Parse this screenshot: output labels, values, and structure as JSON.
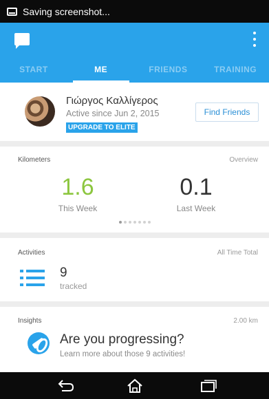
{
  "status_bar": {
    "notification": "Saving screenshot..."
  },
  "app_bar": {
    "tabs": [
      {
        "label": "START",
        "active": false
      },
      {
        "label": "ME",
        "active": true
      },
      {
        "label": "FRIENDS",
        "active": false
      },
      {
        "label": "TRAINING",
        "active": false
      }
    ],
    "accent_color": "#2aa3ea"
  },
  "profile": {
    "name": "Γιώργος Καλλίγερος",
    "active_since": "Active since Jun 2, 2015",
    "upgrade_label": "UPGRADE TO ELITE",
    "find_friends_label": "Find Friends"
  },
  "kilometers": {
    "title": "Kilometers",
    "aside": "Overview",
    "this_week": {
      "value": "1.6",
      "label": "This Week",
      "color": "#8cc63f"
    },
    "last_week": {
      "value": "0.1",
      "label": "Last Week"
    },
    "pager": {
      "count": 7,
      "active": 0
    }
  },
  "activities": {
    "title": "Activities",
    "aside": "All Time Total",
    "count": "9",
    "count_label": "tracked"
  },
  "insights": {
    "title": "Insights",
    "aside": "2.00 km",
    "headline": "Are you progressing?",
    "subtext": "Learn more about those 9 activities!"
  },
  "icons": [
    "screenshot-icon",
    "chat-icon",
    "overflow-menu-icon",
    "avatar",
    "list-icon",
    "insight-icon",
    "back-icon",
    "home-icon",
    "recent-apps-icon"
  ]
}
